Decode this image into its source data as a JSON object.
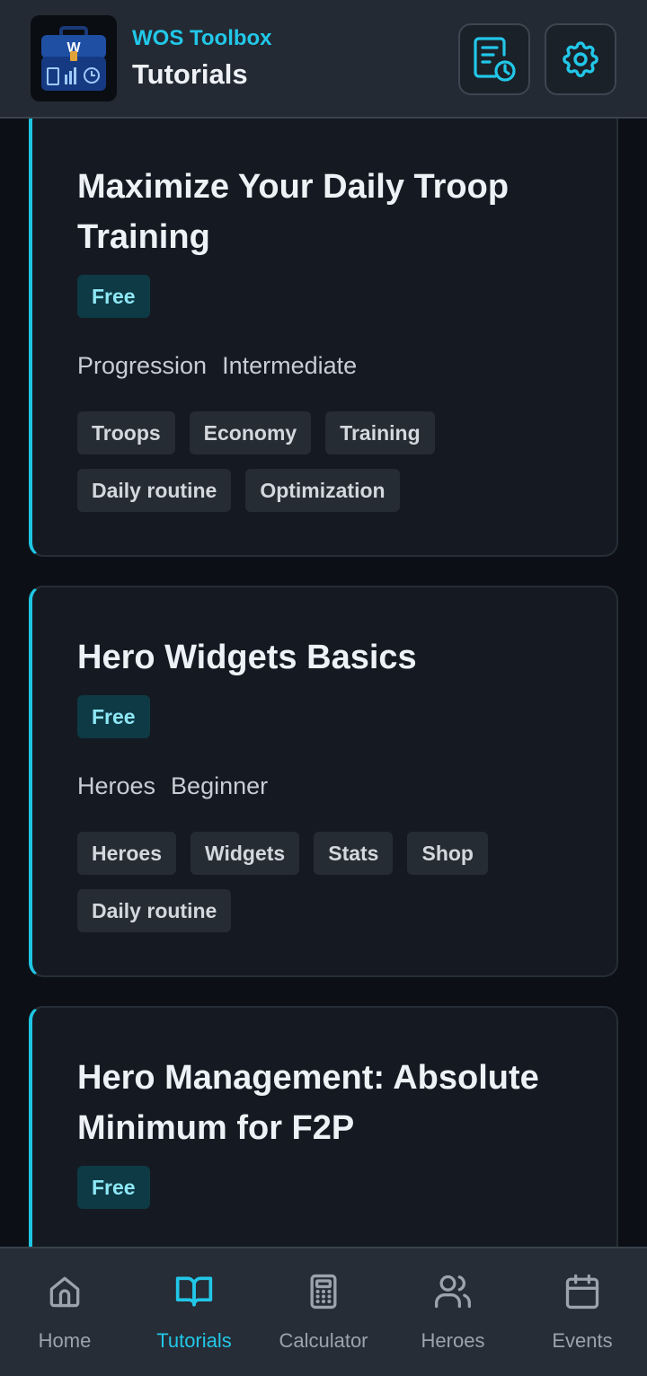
{
  "header": {
    "app_name": "WOS Toolbox",
    "page_title": "Tutorials",
    "logo_letter": "W"
  },
  "tutorials": [
    {
      "title": "Maximize Your Daily Troop Training",
      "badge": "Free",
      "category": "Progression",
      "level": "Intermediate",
      "tags": [
        "Troops",
        "Economy",
        "Training",
        "Daily routine",
        "Optimization"
      ]
    },
    {
      "title": "Hero Widgets Basics",
      "badge": "Free",
      "category": "Heroes",
      "level": "Beginner",
      "tags": [
        "Heroes",
        "Widgets",
        "Stats",
        "Shop",
        "Daily routine"
      ]
    },
    {
      "title": "Hero Management: Absolute Minimum for F2P",
      "badge": "Free"
    }
  ],
  "nav": {
    "items": [
      {
        "label": "Home",
        "icon": "home-icon"
      },
      {
        "label": "Tutorials",
        "icon": "book-icon"
      },
      {
        "label": "Calculator",
        "icon": "calculator-icon"
      },
      {
        "label": "Heroes",
        "icon": "users-icon"
      },
      {
        "label": "Events",
        "icon": "calendar-icon"
      }
    ],
    "active": "Tutorials"
  },
  "colors": {
    "accent": "#22c7e8",
    "background": "#0c1016",
    "card": "#151a22",
    "header": "#232a33",
    "badge_bg": "#0e3a45",
    "tag_bg": "#262c34",
    "nav_inactive": "#9ba3ad"
  }
}
